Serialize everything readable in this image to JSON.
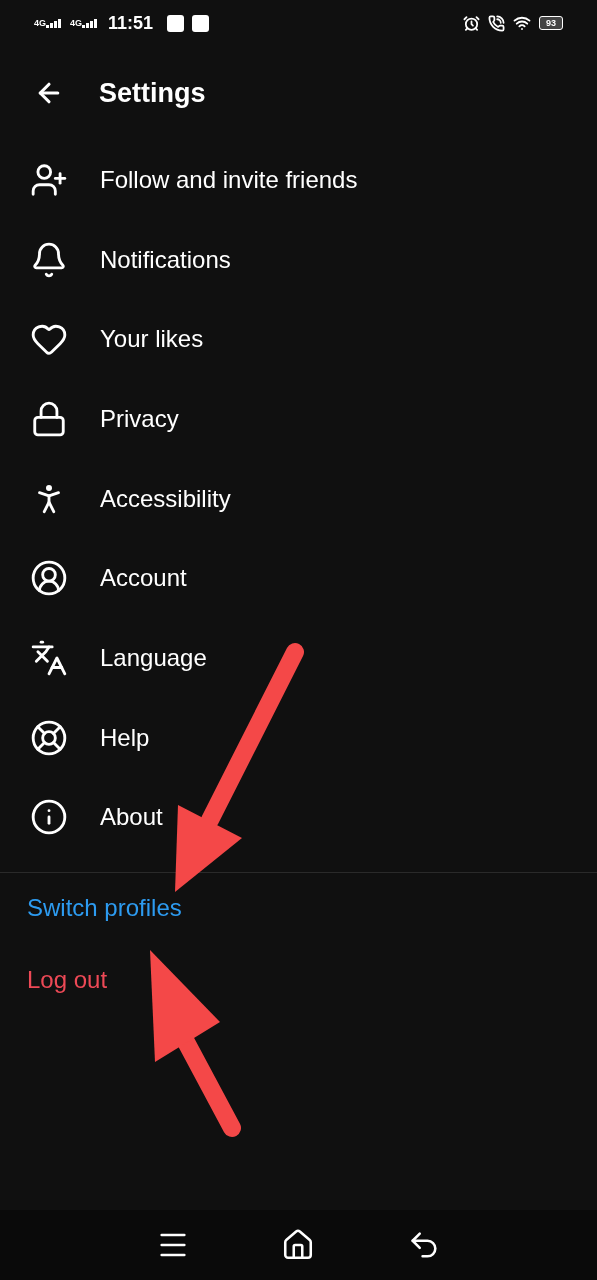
{
  "status_bar": {
    "networks": [
      "4G",
      "4G"
    ],
    "time": "11:51",
    "battery": "93"
  },
  "header": {
    "title": "Settings"
  },
  "menu": [
    {
      "kind": "follow",
      "label": "Follow and invite friends"
    },
    {
      "kind": "bell",
      "label": "Notifications"
    },
    {
      "kind": "heart",
      "label": "Your likes"
    },
    {
      "kind": "lock",
      "label": "Privacy"
    },
    {
      "kind": "accessibility",
      "label": "Accessibility"
    },
    {
      "kind": "account",
      "label": "Account"
    },
    {
      "kind": "language",
      "label": "Language"
    },
    {
      "kind": "help",
      "label": "Help"
    },
    {
      "kind": "about",
      "label": "About"
    }
  ],
  "actions": [
    {
      "kind": "link",
      "label": "Switch profiles"
    },
    {
      "kind": "danger",
      "label": "Log out"
    }
  ]
}
